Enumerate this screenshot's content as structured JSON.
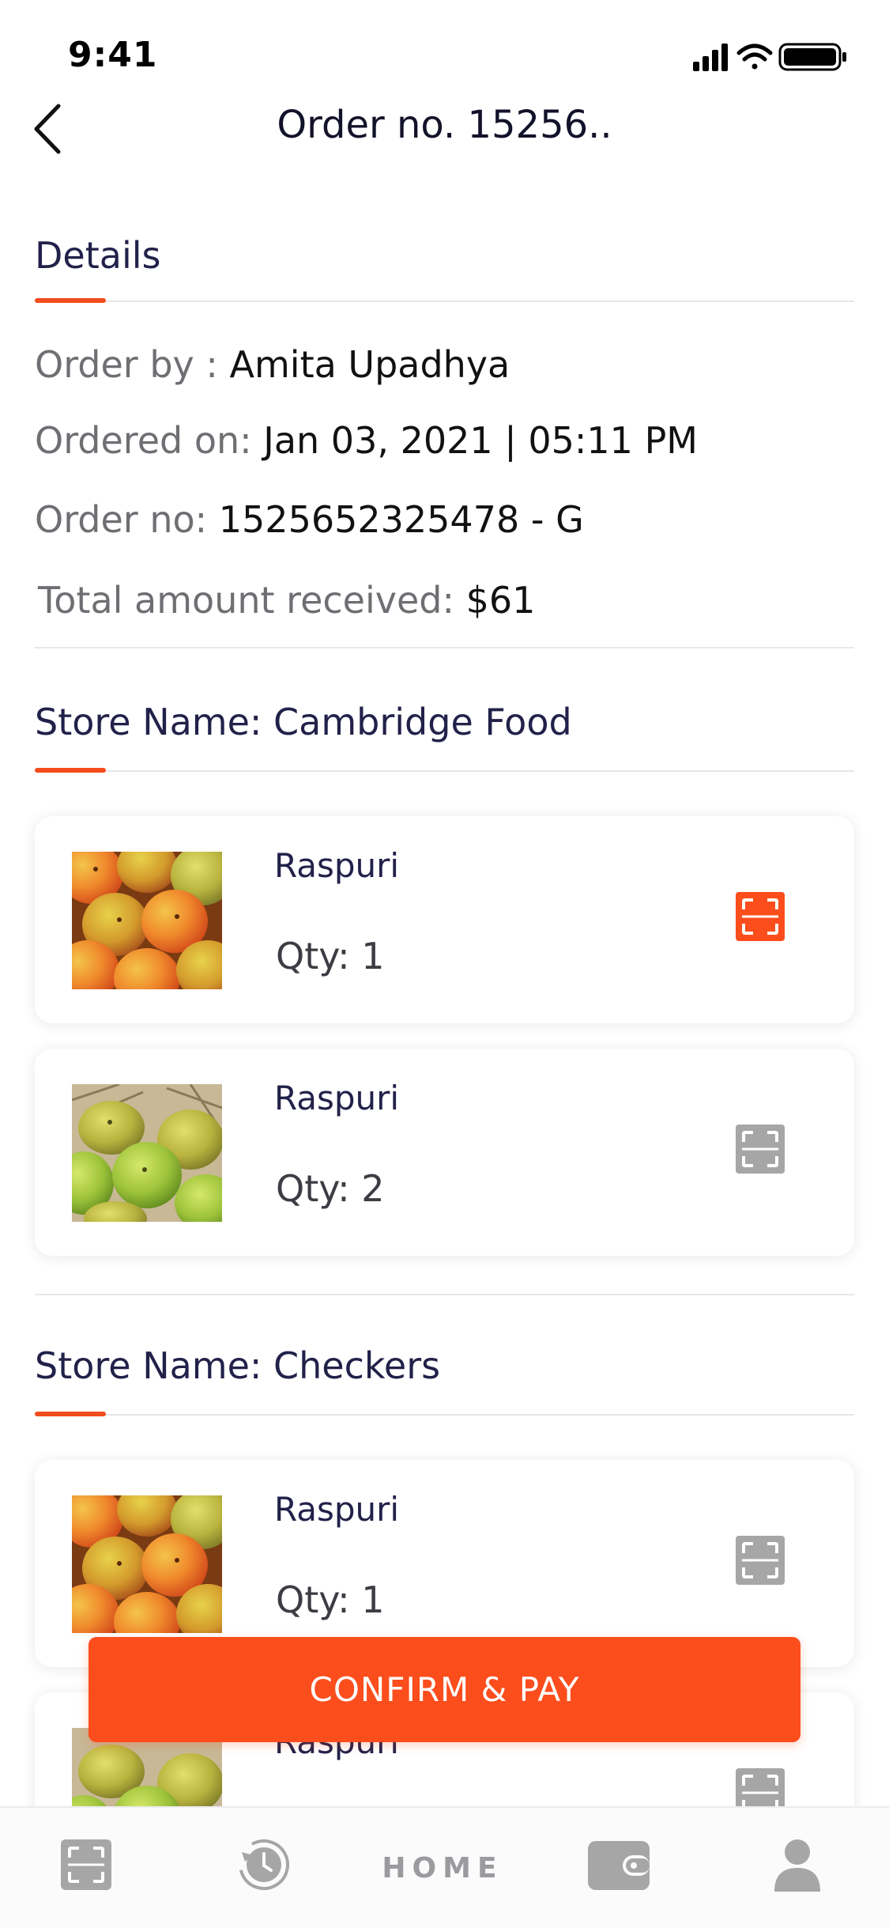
{
  "status_bar": {
    "time": "9:41"
  },
  "header": {
    "title": "Order no. 15256.."
  },
  "details": {
    "heading": "Details",
    "order_by_label": "Order by : ",
    "order_by_value": "Amita Upadhya",
    "ordered_on_label": "Ordered on: ",
    "ordered_on_value": "Jan 03, 2021 | 05:11 PM",
    "order_no_label": "Order no: ",
    "order_no_value": "1525652325478 - G",
    "total_label": "Total amount received: ",
    "total_value": "$61"
  },
  "stores": [
    {
      "heading": "Store Name: Cambridge Food",
      "items": [
        {
          "name": "Raspuri",
          "qty": "Qty: 1",
          "image": "orange-mangoes",
          "scan_state": "active"
        },
        {
          "name": "Raspuri",
          "qty": "Qty: 2",
          "image": "green-mangoes",
          "scan_state": "inactive"
        }
      ]
    },
    {
      "heading": "Store Name: Checkers",
      "items": [
        {
          "name": "Raspuri",
          "qty": "Qty: 1",
          "image": "orange-mangoes",
          "scan_state": "inactive"
        },
        {
          "name": "Raspuri",
          "qty": "",
          "image": "green-mangoes",
          "scan_state": "inactive"
        }
      ]
    }
  ],
  "confirm_button": {
    "label": "CONFIRM & PAY"
  },
  "bottom_nav": {
    "items": [
      {
        "icon": "scan-icon"
      },
      {
        "icon": "history-icon"
      },
      {
        "label": "HOME"
      },
      {
        "icon": "wallet-icon"
      },
      {
        "icon": "profile-icon"
      }
    ]
  },
  "colors": {
    "accent": "#fc4d1c",
    "text_dark": "#1c1b33",
    "text_muted": "#6e6e73",
    "icon_inactive": "#a6a6a6"
  }
}
